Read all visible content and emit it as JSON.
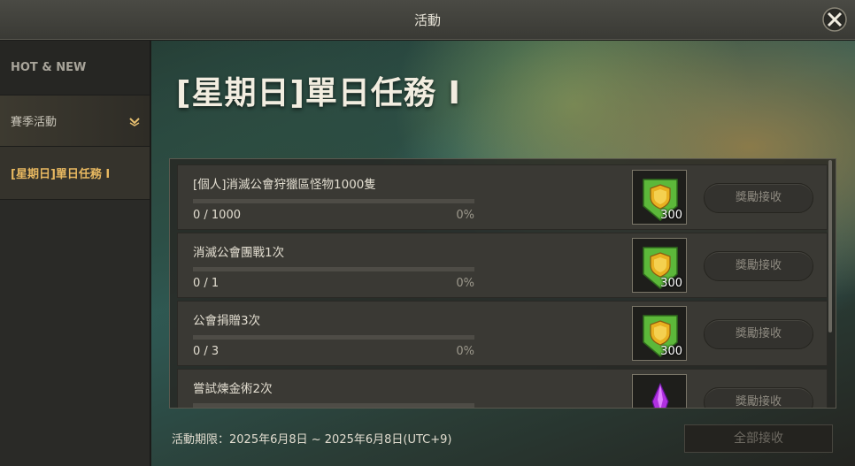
{
  "window": {
    "title": "活動"
  },
  "sidebar": {
    "items": [
      {
        "label": "HOT & NEW"
      },
      {
        "label": "賽季活動"
      },
      {
        "label": "[星期日]單日任務 I"
      }
    ]
  },
  "main": {
    "title": "[星期日]單日任務 I",
    "missions": [
      {
        "name": "[個人]消滅公會狩獵區怪物1000隻",
        "count": "0 / 1000",
        "percent": "0%",
        "progress": 0,
        "reward_icon": "guild-shield-icon",
        "reward_amount": "300",
        "claim_label": "獎勵接收"
      },
      {
        "name": "消滅公會團戰1次",
        "count": "0 / 1",
        "percent": "0%",
        "progress": 0,
        "reward_icon": "guild-shield-icon",
        "reward_amount": "300",
        "claim_label": "獎勵接收"
      },
      {
        "name": "公會捐贈3次",
        "count": "0 / 3",
        "percent": "0%",
        "progress": 0,
        "reward_icon": "guild-shield-icon",
        "reward_amount": "300",
        "claim_label": "獎勵接收"
      },
      {
        "name": "嘗試煉金術2次",
        "count": "",
        "percent": "",
        "progress": 0,
        "reward_icon": "purple-crystal-icon",
        "reward_amount": "",
        "claim_label": "獎勵接收"
      }
    ],
    "period": "活動期限：2025年6月8日 ~ 2025年6月8日(UTC+9)",
    "claim_all_label": "全部接收"
  },
  "colors": {
    "accent": "#e8b860",
    "shield_green": "#5cb83a",
    "shield_gold": "#e8b020"
  }
}
